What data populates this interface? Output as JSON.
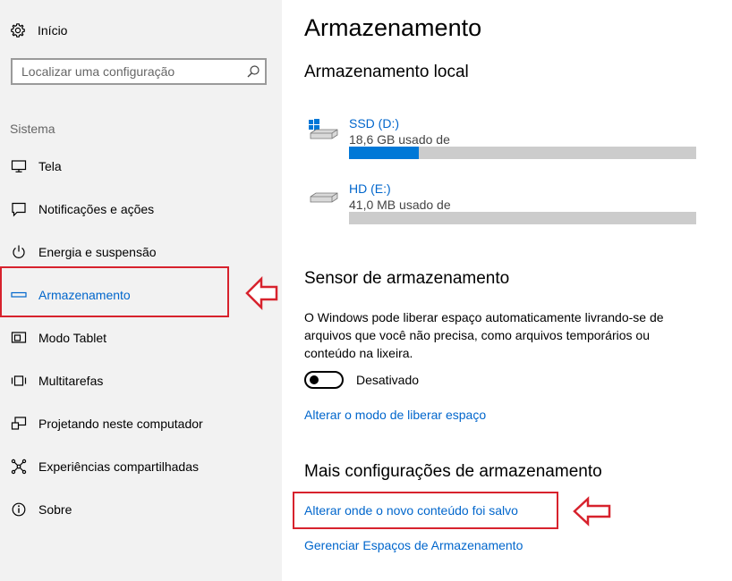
{
  "sidebar": {
    "home_label": "Início",
    "search_placeholder": "Localizar uma configuração",
    "section_label": "Sistema",
    "items": [
      {
        "label": "Tela",
        "icon": "monitor-icon"
      },
      {
        "label": "Notificações e ações",
        "icon": "notification-icon"
      },
      {
        "label": "Energia e suspensão",
        "icon": "power-icon"
      },
      {
        "label": "Armazenamento",
        "icon": "storage-icon",
        "active": true
      },
      {
        "label": "Modo Tablet",
        "icon": "tablet-icon"
      },
      {
        "label": "Multitarefas",
        "icon": "multitask-icon"
      },
      {
        "label": "Projetando neste computador",
        "icon": "project-icon"
      },
      {
        "label": "Experiências compartilhadas",
        "icon": "shared-icon"
      },
      {
        "label": "Sobre",
        "icon": "info-icon"
      }
    ]
  },
  "main": {
    "title": "Armazenamento",
    "local_heading": "Armazenamento local",
    "drives": [
      {
        "name": "SSD (D:)",
        "used_text": "18,6 GB usado de",
        "fill_fraction": 0.2
      },
      {
        "name": "HD (E:)",
        "used_text": "41,0 MB usado de",
        "fill_fraction": 0.0
      }
    ],
    "sensor_heading": "Sensor de armazenamento",
    "sensor_description": "O Windows pode liberar espaço automaticamente livrando-se de arquivos que você não precisa, como arquivos temporários ou conteúdo na lixeira.",
    "toggle_state": "Desativado",
    "change_free_space_link": "Alterar o modo de liberar espaço",
    "more_heading": "Mais configurações de armazenamento",
    "change_save_location_link": "Alterar onde o novo conteúdo foi salvo",
    "manage_spaces_link": "Gerenciar Espaços de Armazenamento"
  },
  "colors": {
    "accent": "#0066cc",
    "bar_fill": "#0078d7",
    "bar_track": "#cccccc",
    "annotation": "#d7222d"
  }
}
